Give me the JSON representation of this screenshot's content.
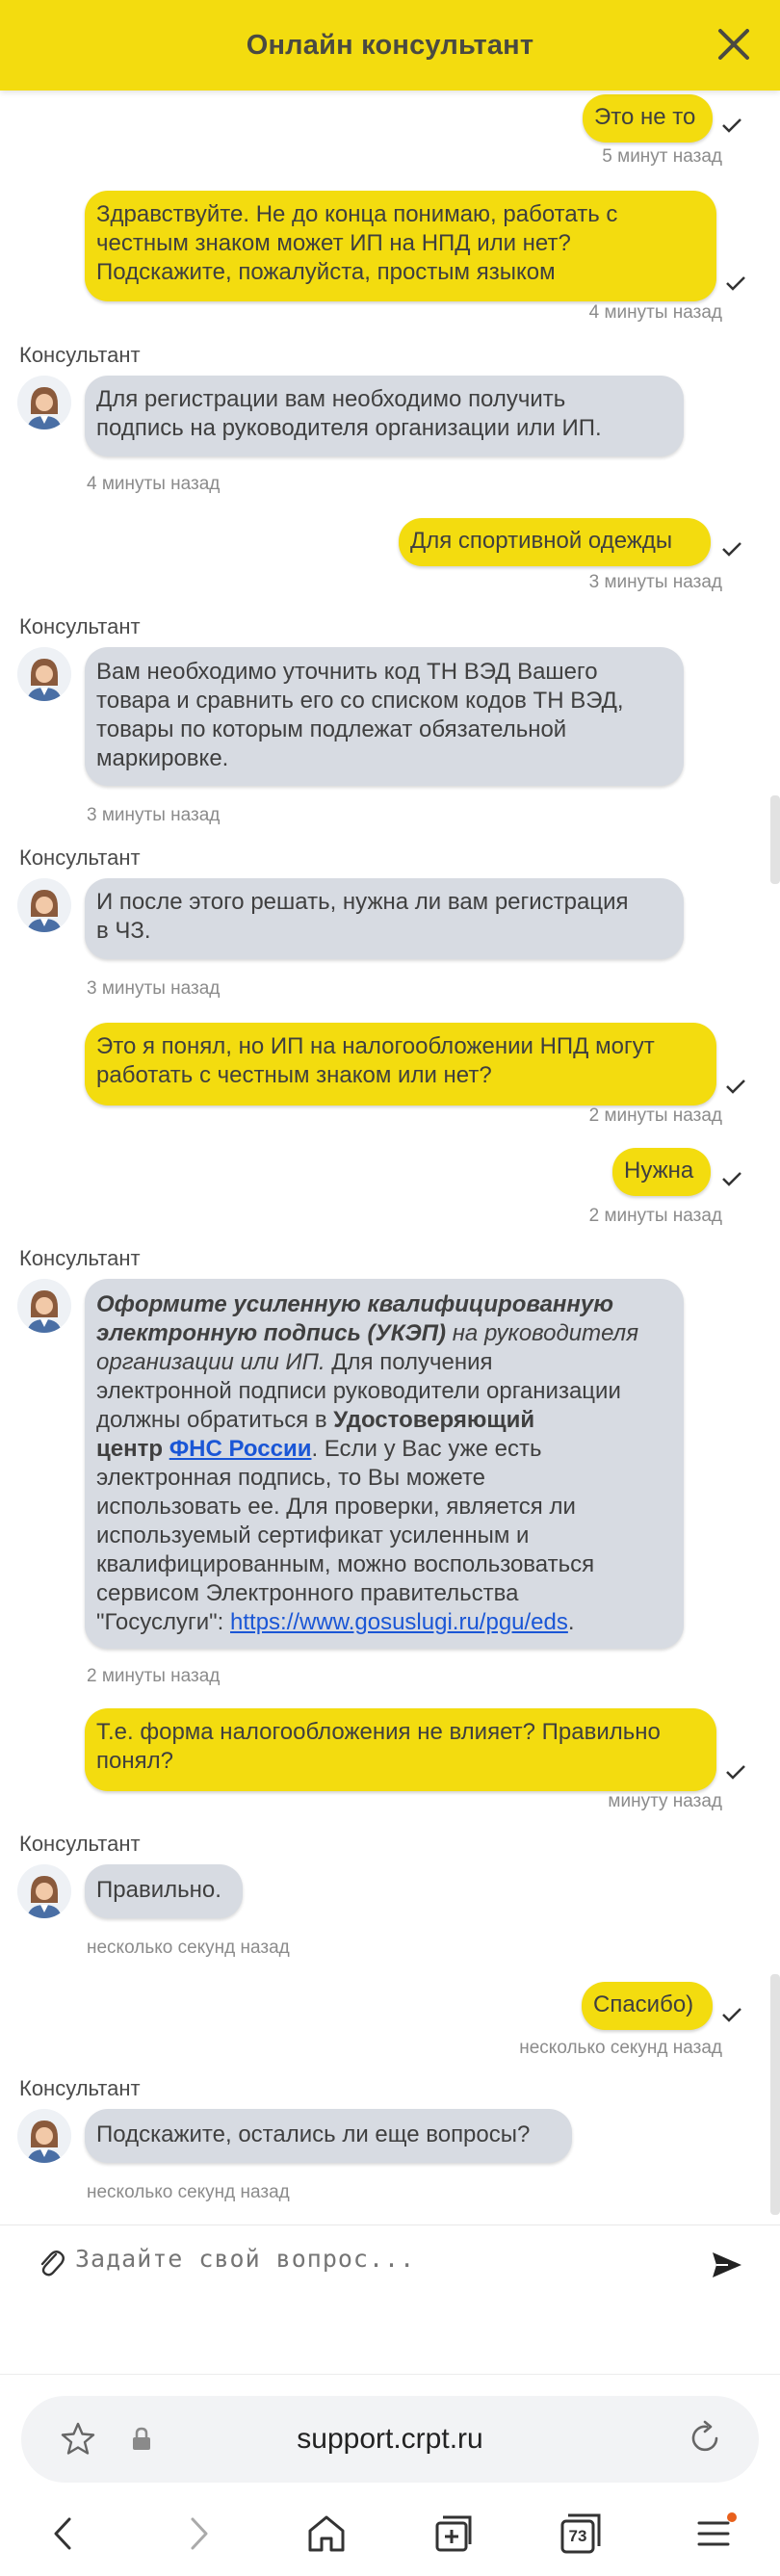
{
  "header": {
    "title": "Онлайн консультант",
    "close_icon": "close-icon"
  },
  "messages": {
    "m1": {
      "text": "Это не то",
      "time": "5 минут назад"
    },
    "m2": {
      "lines": [
        "Здравствуйте. Не до конца понимаю, работать с",
        "честным знаком может ИП на НПД или нет?",
        "Подскажите, пожалуйста, простым языком"
      ],
      "time": "4 минуты назад"
    },
    "m3": {
      "sender": "Консультант",
      "lines": [
        "Для регистрации вам необходимо получить",
        "подпись на руководителя организации или ИП."
      ],
      "time": "4 минуты назад"
    },
    "m4": {
      "text": "Для спортивной одежды",
      "time": "3 минуты назад"
    },
    "m5": {
      "sender": "Консультант",
      "lines": [
        "Вам необходимо уточнить код ТН ВЭД Вашего",
        "товара и сравнить его со списком кодов ТН ВЭД,",
        "товары по которым подлежат обязательной",
        "маркировке."
      ],
      "time": "3 минуты назад"
    },
    "m6": {
      "sender": "Консультант",
      "lines": [
        "И после этого решать, нужна ли вам регистрация",
        "в ЧЗ."
      ],
      "time": "3 минуты назад"
    },
    "m7": {
      "lines": [
        "Это я понял, но ИП на налогообложении НПД могут",
        "работать с честным знаком или нет?"
      ],
      "time": "2 минуты назад"
    },
    "m8": {
      "text": "Нужна",
      "time": "2 минуты назад"
    },
    "m9": {
      "sender": "Консультант",
      "l1": "Оформите усиленную квалифицированную",
      "l2a": "электронную подпись (УКЭП)",
      "l2b": " на руководителя",
      "l3": "организации или ИП.",
      "l3b": "  Для получения",
      "l4": "электронной подписи руководители организации",
      "l5a": "должны обратиться в ",
      "l5b": "Удостоверяющий",
      "l6a": "центр",
      "l6b": "ФНС России",
      "l6c": ". Если у Вас уже есть",
      "l7": "электронная подпись, то Вы можете",
      "l8": "использовать ее. Для проверки, является ли",
      "l9": "используемый сертификат усиленным и",
      "l10": "квалифицированным, можно воспользоваться",
      "l11": "сервисом Электронного правительства",
      "l12a": "\"Госуслуги\": ",
      "l12b": "https://www.gosuslugi.ru/pgu/eds",
      "l12c": ".",
      "time": "2 минуты назад"
    },
    "m10": {
      "lines": [
        "Т.е. форма налогообложения не влияет? Правильно",
        "понял?"
      ],
      "time": "минуту назад"
    },
    "m11": {
      "sender": "Консультант",
      "text": "Правильно.",
      "time": "несколько секунд назад"
    },
    "m12": {
      "text": "Спасибо)",
      "time": "несколько секунд назад"
    },
    "m13": {
      "sender": "Консультант",
      "text": "Подскажите, остались ли еще вопросы?",
      "time": "несколько секунд назад"
    }
  },
  "composer": {
    "placeholder": "Задайте свой вопрос...",
    "attach_icon": "paperclip-icon",
    "send_icon": "send-icon"
  },
  "browser": {
    "url": "support.crpt.ru",
    "tabs_count": "73"
  },
  "colors": {
    "accent": "#f3dc0f",
    "bot_bubble": "#d7dbe2",
    "link": "#1a56d6"
  }
}
